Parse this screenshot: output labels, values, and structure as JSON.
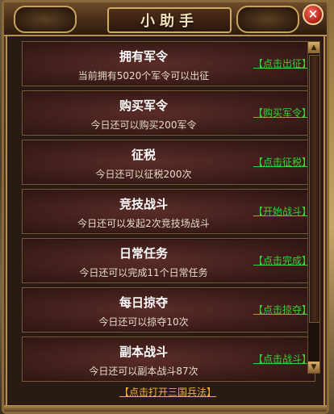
{
  "window": {
    "title": "小助手",
    "close_glyph": "×"
  },
  "tasks": [
    {
      "title": "拥有军令",
      "desc": "当前拥有5020个军令可以出征",
      "link": "【点击出征】"
    },
    {
      "title": "购买军令",
      "desc": "今日还可以购买200军令",
      "link": "【购买军令】"
    },
    {
      "title": "征税",
      "desc": "今日还可以征税200次",
      "link": "【点击征税】"
    },
    {
      "title": "竞技战斗",
      "desc": "今日还可以发起2次竞技场战斗",
      "link": "【开始战斗】"
    },
    {
      "title": "日常任务",
      "desc": "今日还可以完成11个日常任务",
      "link": "【点击完成】"
    },
    {
      "title": "每日掠夺",
      "desc": "今日还可以掠夺10次",
      "link": "【点击掠夺】"
    },
    {
      "title": "副本战斗",
      "desc": "今日还可以副本战斗87次",
      "link": "【点击战斗】"
    }
  ],
  "footer": {
    "link": "【点击打开三国兵法】"
  },
  "colors": {
    "link_green": "#3ad13a",
    "link_orange": "#f0b23a",
    "title_white": "#ffffff"
  }
}
